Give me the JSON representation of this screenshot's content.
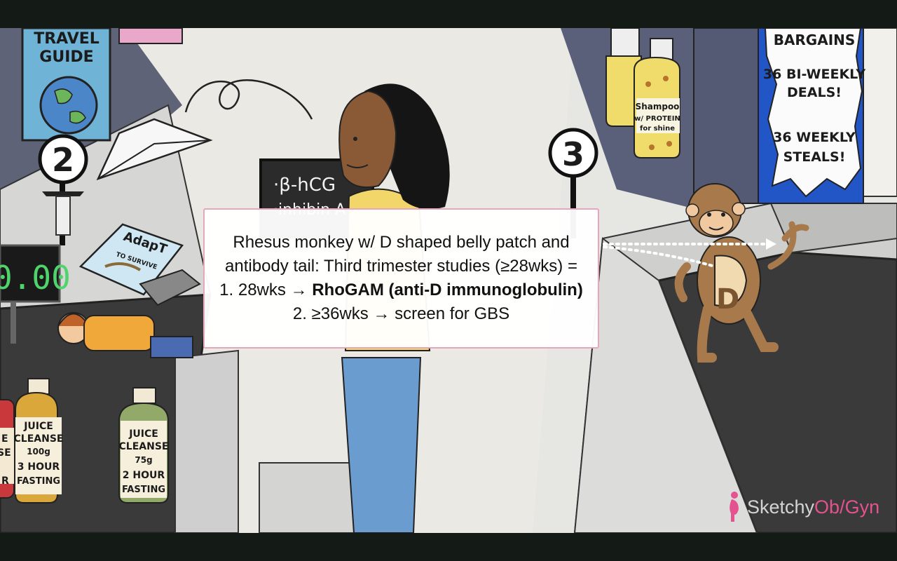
{
  "scene": {
    "book_travel": [
      "TRAVEL",
      "GUIDE"
    ],
    "marker_left": "2",
    "marker_right": "3",
    "board_lines": [
      "·β-hCG",
      "·inhibin A"
    ],
    "book_adapt": [
      "AdapT",
      "TO SURVIVE"
    ],
    "scale_value": "0.00",
    "shampoo": [
      "Shampoo",
      "w/ PROTEIN",
      "for shine"
    ],
    "sign_lines": [
      "BARGAINS",
      "36 BI-WEEKLY",
      "DEALS!",
      "36 WEEKLY",
      "STEALS!"
    ],
    "juice_left": [
      "JUICE",
      "CLEANSE",
      "100g",
      "3 HOUR",
      "FASTING"
    ],
    "juice_right": [
      "JUICE",
      "CLEANSE",
      "75g",
      "2 HOUR",
      "FASTING"
    ],
    "juice_edge": [
      "E",
      "SE",
      "R"
    ],
    "monkey_belly": "D"
  },
  "caption": {
    "line1": "Rhesus monkey w/ D shaped belly patch and antibody tail: Third trimester studies (≥28wks) = 1. 28wks → ",
    "bold": "RhoGAM (anti-D immunoglobulin)",
    "line2": " 2. ≥36wks → screen for GBS"
  },
  "brand": {
    "prefix": "Sketchy",
    "suffix": "Ob/Gyn"
  },
  "colors": {
    "caption_border": "#e7a6bd",
    "brand_accent": "#e4528f",
    "belt": "#3a3a3a",
    "monkey": "#a8794a"
  }
}
